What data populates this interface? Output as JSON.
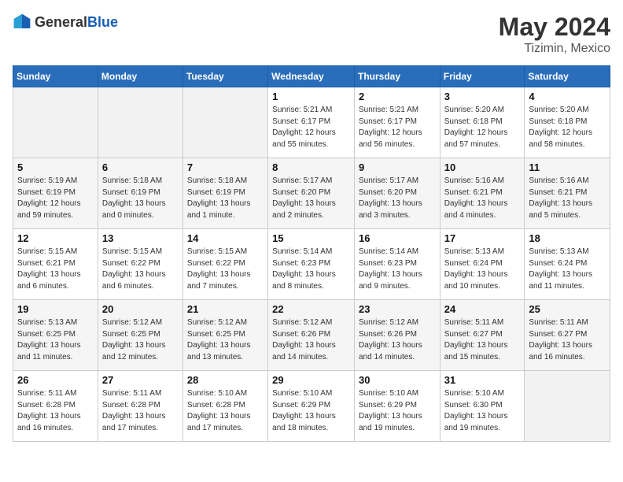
{
  "header": {
    "logo_general": "General",
    "logo_blue": "Blue",
    "month": "May 2024",
    "location": "Tizimin, Mexico"
  },
  "days_of_week": [
    "Sunday",
    "Monday",
    "Tuesday",
    "Wednesday",
    "Thursday",
    "Friday",
    "Saturday"
  ],
  "weeks": [
    [
      {
        "day": "",
        "info": ""
      },
      {
        "day": "",
        "info": ""
      },
      {
        "day": "",
        "info": ""
      },
      {
        "day": "1",
        "info": "Sunrise: 5:21 AM\nSunset: 6:17 PM\nDaylight: 12 hours and 55 minutes."
      },
      {
        "day": "2",
        "info": "Sunrise: 5:21 AM\nSunset: 6:17 PM\nDaylight: 12 hours and 56 minutes."
      },
      {
        "day": "3",
        "info": "Sunrise: 5:20 AM\nSunset: 6:18 PM\nDaylight: 12 hours and 57 minutes."
      },
      {
        "day": "4",
        "info": "Sunrise: 5:20 AM\nSunset: 6:18 PM\nDaylight: 12 hours and 58 minutes."
      }
    ],
    [
      {
        "day": "5",
        "info": "Sunrise: 5:19 AM\nSunset: 6:19 PM\nDaylight: 12 hours and 59 minutes."
      },
      {
        "day": "6",
        "info": "Sunrise: 5:18 AM\nSunset: 6:19 PM\nDaylight: 13 hours and 0 minutes."
      },
      {
        "day": "7",
        "info": "Sunrise: 5:18 AM\nSunset: 6:19 PM\nDaylight: 13 hours and 1 minute."
      },
      {
        "day": "8",
        "info": "Sunrise: 5:17 AM\nSunset: 6:20 PM\nDaylight: 13 hours and 2 minutes."
      },
      {
        "day": "9",
        "info": "Sunrise: 5:17 AM\nSunset: 6:20 PM\nDaylight: 13 hours and 3 minutes."
      },
      {
        "day": "10",
        "info": "Sunrise: 5:16 AM\nSunset: 6:21 PM\nDaylight: 13 hours and 4 minutes."
      },
      {
        "day": "11",
        "info": "Sunrise: 5:16 AM\nSunset: 6:21 PM\nDaylight: 13 hours and 5 minutes."
      }
    ],
    [
      {
        "day": "12",
        "info": "Sunrise: 5:15 AM\nSunset: 6:21 PM\nDaylight: 13 hours and 6 minutes."
      },
      {
        "day": "13",
        "info": "Sunrise: 5:15 AM\nSunset: 6:22 PM\nDaylight: 13 hours and 6 minutes."
      },
      {
        "day": "14",
        "info": "Sunrise: 5:15 AM\nSunset: 6:22 PM\nDaylight: 13 hours and 7 minutes."
      },
      {
        "day": "15",
        "info": "Sunrise: 5:14 AM\nSunset: 6:23 PM\nDaylight: 13 hours and 8 minutes."
      },
      {
        "day": "16",
        "info": "Sunrise: 5:14 AM\nSunset: 6:23 PM\nDaylight: 13 hours and 9 minutes."
      },
      {
        "day": "17",
        "info": "Sunrise: 5:13 AM\nSunset: 6:24 PM\nDaylight: 13 hours and 10 minutes."
      },
      {
        "day": "18",
        "info": "Sunrise: 5:13 AM\nSunset: 6:24 PM\nDaylight: 13 hours and 11 minutes."
      }
    ],
    [
      {
        "day": "19",
        "info": "Sunrise: 5:13 AM\nSunset: 6:25 PM\nDaylight: 13 hours and 11 minutes."
      },
      {
        "day": "20",
        "info": "Sunrise: 5:12 AM\nSunset: 6:25 PM\nDaylight: 13 hours and 12 minutes."
      },
      {
        "day": "21",
        "info": "Sunrise: 5:12 AM\nSunset: 6:25 PM\nDaylight: 13 hours and 13 minutes."
      },
      {
        "day": "22",
        "info": "Sunrise: 5:12 AM\nSunset: 6:26 PM\nDaylight: 13 hours and 14 minutes."
      },
      {
        "day": "23",
        "info": "Sunrise: 5:12 AM\nSunset: 6:26 PM\nDaylight: 13 hours and 14 minutes."
      },
      {
        "day": "24",
        "info": "Sunrise: 5:11 AM\nSunset: 6:27 PM\nDaylight: 13 hours and 15 minutes."
      },
      {
        "day": "25",
        "info": "Sunrise: 5:11 AM\nSunset: 6:27 PM\nDaylight: 13 hours and 16 minutes."
      }
    ],
    [
      {
        "day": "26",
        "info": "Sunrise: 5:11 AM\nSunset: 6:28 PM\nDaylight: 13 hours and 16 minutes."
      },
      {
        "day": "27",
        "info": "Sunrise: 5:11 AM\nSunset: 6:28 PM\nDaylight: 13 hours and 17 minutes."
      },
      {
        "day": "28",
        "info": "Sunrise: 5:10 AM\nSunset: 6:28 PM\nDaylight: 13 hours and 17 minutes."
      },
      {
        "day": "29",
        "info": "Sunrise: 5:10 AM\nSunset: 6:29 PM\nDaylight: 13 hours and 18 minutes."
      },
      {
        "day": "30",
        "info": "Sunrise: 5:10 AM\nSunset: 6:29 PM\nDaylight: 13 hours and 19 minutes."
      },
      {
        "day": "31",
        "info": "Sunrise: 5:10 AM\nSunset: 6:30 PM\nDaylight: 13 hours and 19 minutes."
      },
      {
        "day": "",
        "info": ""
      }
    ]
  ]
}
